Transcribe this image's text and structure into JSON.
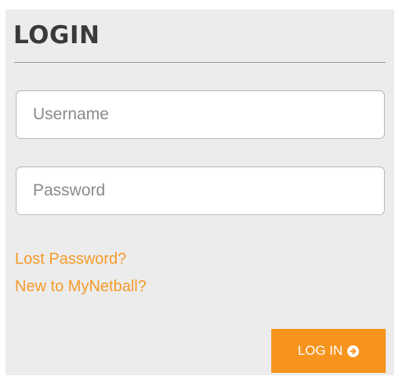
{
  "login": {
    "title": "LOGIN",
    "username": {
      "placeholder": "Username",
      "value": ""
    },
    "password": {
      "placeholder": "Password",
      "value": ""
    },
    "links": {
      "lost_password": "Lost Password?",
      "new_user": "New to MyNetball?"
    },
    "submit": {
      "label": "LOG IN",
      "icon": "circle-arrow-right-icon"
    }
  },
  "colors": {
    "panel_background": "#ececec",
    "accent": "#f7941d",
    "link": "#f59a2a",
    "title": "#3a3a3a"
  }
}
